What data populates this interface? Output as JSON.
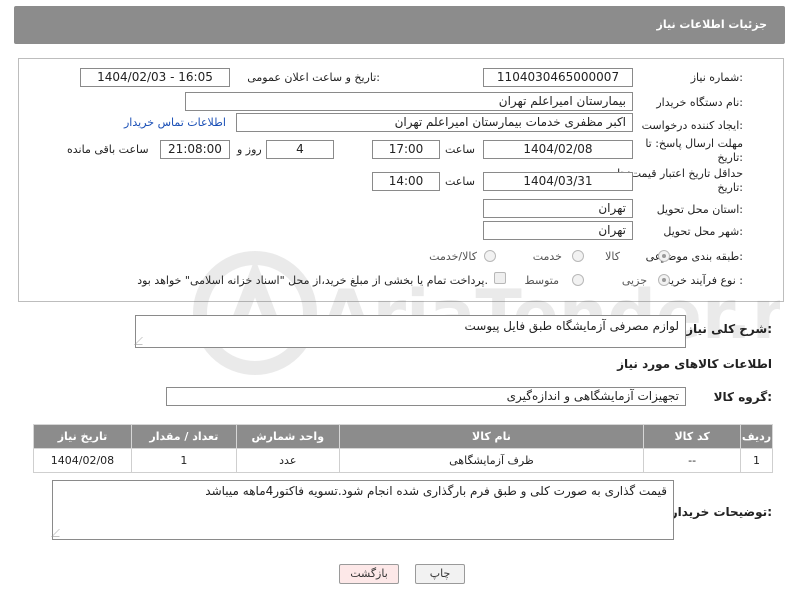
{
  "header": {
    "title": "جزئیات اطلاعات نیاز"
  },
  "form": {
    "need_number_label": "شماره نیاز:",
    "need_number": "1104030465000007",
    "announce_label": "تاریخ و ساعت اعلان عمومی:",
    "announce_value": "1404/02/03 - 16:05",
    "buyer_org_label": "نام دستگاه خریدار:",
    "buyer_org": "بیمارستان امیراعلم تهران",
    "creator_label": "ایجاد کننده درخواست:",
    "creator": "اکبر مظفری خدمات بیمارستان امیراعلم تهران",
    "contact_link": "اطلاعات تماس خریدار",
    "deadline_label": "مهلت ارسال پاسخ: تا تاریخ:",
    "deadline_date": "1404/02/08",
    "time_label": "ساعت",
    "deadline_time": "17:00",
    "days_value": "4",
    "days_label": "روز و",
    "remaining_time": "21:08:00",
    "remaining_label": "ساعت باقی مانده",
    "validity_label": "حداقل تاریخ اعتبار قیمت: تا تاریخ:",
    "validity_date": "1404/03/31",
    "validity_time": "14:00",
    "province_label": "استان محل تحویل:",
    "province": "تهران",
    "city_label": "شهر محل تحویل:",
    "city": "تهران",
    "category_label": "طبقه بندی موضوعی:",
    "category_options": [
      "کالا",
      "خدمت",
      "کالا/خدمت"
    ],
    "process_label": "نوع فرآیند خرید :",
    "process_options": [
      "جزیی",
      "متوسط"
    ],
    "payment_note": "پرداخت تمام یا بخشی از مبلغ خرید،از محل \"اسناد خزانه اسلامی\" خواهد بود."
  },
  "description": {
    "label": "شرح کلی نیاز:",
    "value": "لوازم مصرفی آزمایشگاه طبق فایل پیوست"
  },
  "goods": {
    "section_title": "اطلاعات کالاهای مورد نیاز",
    "group_label": "گروه کالا:",
    "group_value": "تجهیزات آزمایشگاهی و اندازه‌گیری",
    "columns": [
      "ردیف",
      "کد کالا",
      "نام کالا",
      "واحد شمارش",
      "تعداد / مقدار",
      "تاریخ نیاز"
    ],
    "rows": [
      [
        "1",
        "--",
        "ظرف آزمایشگاهی",
        "عدد",
        "1",
        "1404/02/08"
      ]
    ]
  },
  "buyer_notes": {
    "label": "توضیحات خریدار:",
    "value": "قیمت گذاری به صورت کلی و طبق فرم بارگذاری شده انجام شود.تسویه فاکتور4ماهه میباشد"
  },
  "buttons": {
    "print": "چاپ",
    "back": "بازگشت"
  },
  "watermark_text": "AriaTender.net"
}
